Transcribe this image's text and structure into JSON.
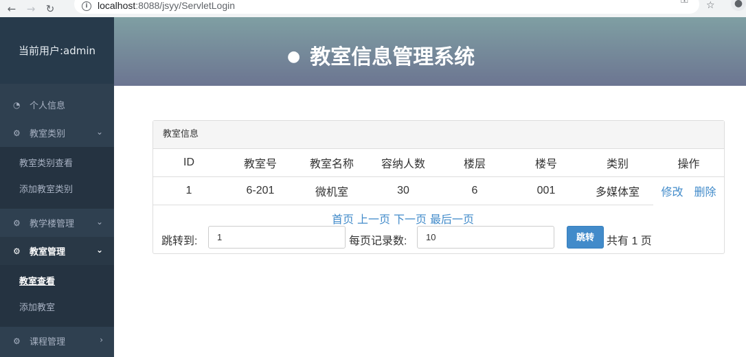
{
  "browser": {
    "url_host": "localhost",
    "url_rest": ":8088/jsyy/ServletLogin"
  },
  "sidebar": {
    "current_user": "当前用户:admin",
    "items": [
      {
        "label": "个人信息",
        "icon": "dashboard-icon"
      },
      {
        "label": "教室类别",
        "icon": "gears-icon",
        "sub": [
          "教室类别查看",
          "添加教室类别"
        ]
      },
      {
        "label": "教学楼管理",
        "icon": "gears-icon"
      },
      {
        "label": "教室管理",
        "icon": "gears-icon",
        "sub": [
          "教室查看",
          "添加教室"
        ]
      },
      {
        "label": "课程管理",
        "icon": "gears-icon"
      }
    ]
  },
  "header": {
    "title": "教室信息管理系统"
  },
  "panel": {
    "title": "教室信息",
    "columns": [
      "ID",
      "教室号",
      "教室名称",
      "容纳人数",
      "楼层",
      "楼号",
      "类别",
      "操作"
    ],
    "rows": [
      {
        "id": "1",
        "room_no": "6-201",
        "name": "微机室",
        "capacity": "30",
        "floor": "6",
        "building": "001",
        "category": "多媒体室",
        "edit": "修改",
        "delete": "删除"
      }
    ],
    "pager": {
      "first": "首页",
      "prev": "上一页",
      "next": "下一页",
      "last": "最后一页",
      "jump_label": "跳转到:",
      "jump_value": "1",
      "per_page_label": "每页记录数:",
      "per_page_value": "10",
      "jump_button": "跳转",
      "total_text": "共有 1 页"
    }
  },
  "colors": {
    "sidebar_bg": "#2f4050",
    "link": "#428bca",
    "button": "#428bca"
  }
}
